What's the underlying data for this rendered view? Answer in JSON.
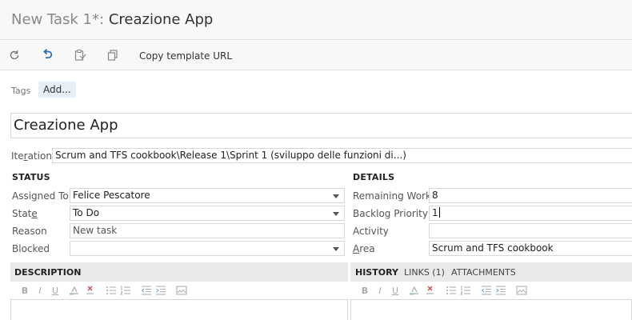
{
  "header": {
    "title_prefix": "New Task 1*:",
    "title_name": "Creazione App"
  },
  "toolbar": {
    "refresh_icon": "refresh-icon",
    "undo_icon": "undo-icon",
    "clipboard_icon": "clipboard-icon",
    "copy_icon": "copy-icon",
    "copy_template_label": "Copy template URL"
  },
  "tags": {
    "label": "Tags",
    "add_label": "Add..."
  },
  "work_item": {
    "title": "Creazione App"
  },
  "iteration": {
    "label_pre": "Ite",
    "label_ul": "r",
    "label_post": "ation",
    "value": "Scrum and TFS cookbook\\Release 1\\Sprint 1 (sviluppo delle funzioni di...)"
  },
  "status": {
    "heading": "STATUS",
    "assigned_label": "Assigned To",
    "assigned_value": "Felice Pescatore",
    "state_label_pre": "Stat",
    "state_label_ul": "e",
    "state_value": "To Do",
    "reason_label": "Reason",
    "reason_value": "New task",
    "blocked_label": "Blocked",
    "blocked_value": ""
  },
  "details": {
    "heading": "DETAILS",
    "remaining_label": "Remaining Work",
    "remaining_value": "8",
    "backlog_label": "Backlog Priority",
    "backlog_value": "1",
    "activity_label": "Activity",
    "activity_value": "",
    "area_label_ul": "A",
    "area_label_post": "rea",
    "area_value": "Scrum and TFS cookbook"
  },
  "description": {
    "heading": "DESCRIPTION"
  },
  "tabs": {
    "history": "HISTORY",
    "links": "LINKS (1)",
    "attachments": "ATTACHMENTS"
  },
  "rte": {
    "bold": "B",
    "italic": "I",
    "underline": "U"
  },
  "colors": {
    "toolbar_bg": "#f8f8f8",
    "tag_bg": "#e6eef6",
    "panel_header_bg": "#e9e9e9",
    "undo_blue": "#2d6fb4"
  }
}
